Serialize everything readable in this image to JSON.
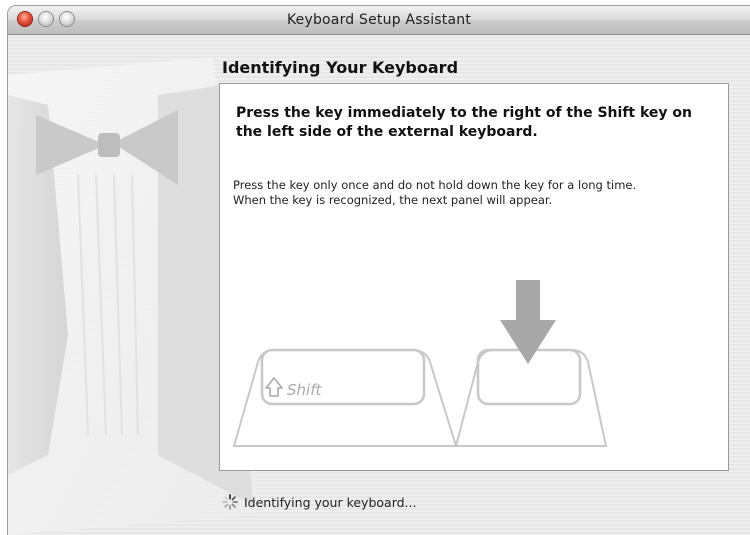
{
  "window": {
    "title": "Keyboard Setup Assistant"
  },
  "page": {
    "heading": "Identifying Your Keyboard"
  },
  "panel": {
    "instruction": "Press the key immediately to the right of the Shift key on the left side of the external keyboard.",
    "detail_line1": "Press the key only once and do not hold down the key for a long time.",
    "detail_line2": "When the key is recognized, the next panel will appear."
  },
  "keys": {
    "shift_label": "Shift",
    "shift_icon": "shift-arrow-icon",
    "indicator_icon": "down-arrow-icon"
  },
  "status": {
    "icon": "spinner-icon",
    "text": "Identifying your keyboard..."
  },
  "colors": {
    "close_button": "#e4523a",
    "key_outline": "#c8c8c8",
    "arrow": "#a8a8a8"
  }
}
